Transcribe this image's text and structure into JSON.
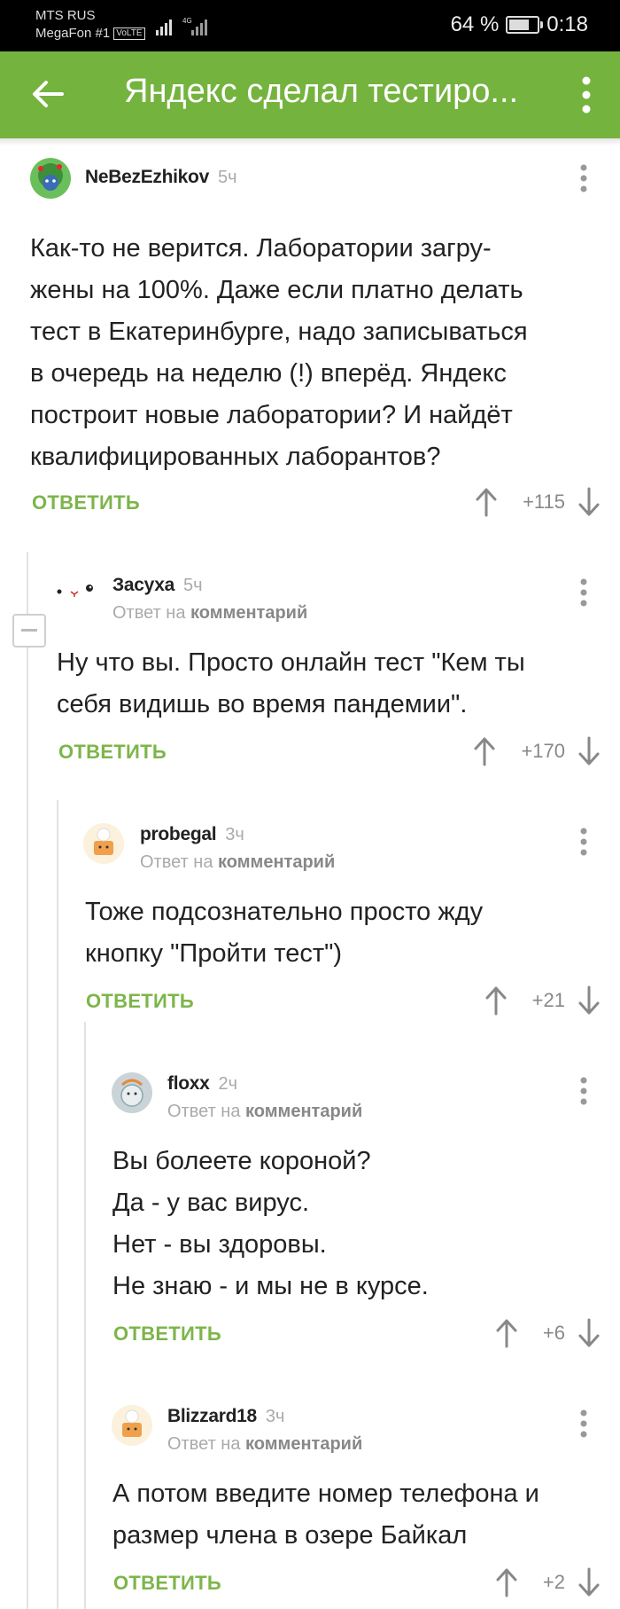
{
  "status_bar": {
    "carrier1": "MTS RUS",
    "carrier2": "MegaFon #1",
    "volte": "VoLTE",
    "network": "4G",
    "battery": "64 %",
    "battery_level": 0.64,
    "time": "0:18"
  },
  "app_bar": {
    "title": "Яндекс сделал тестиро..."
  },
  "comments": [
    {
      "author": "NeBezEzhikov",
      "time": "5ч",
      "lines": [
        "Как-то не верится. Лаборатории загру-",
        "жены на 100%. Даже если платно делать",
        "тест в Екатеринбурге, надо записываться",
        "в очередь на неделю (!) вперёд. Яндекс",
        "построит новые лаборатории? И найдёт",
        "квалифицированных лаборантов?"
      ],
      "reply_label": "ОТВЕТИТЬ",
      "rating": "+115"
    },
    {
      "author": "Засуха",
      "time": "5ч",
      "reply_prefix": "Ответ на",
      "reply_target": "комментарий",
      "lines": [
        "Ну что вы. Просто онлайн тест \"Кем ты",
        "себя видишь во время пандемии\"."
      ],
      "reply_label": "ОТВЕТИТЬ",
      "rating": "+170"
    },
    {
      "author": "probegal",
      "time": "3ч",
      "reply_prefix": "Ответ на",
      "reply_target": "комментарий",
      "lines": [
        "Тоже подсознательно просто жду",
        "кнопку \"Пройти тест\")"
      ],
      "reply_label": "ОТВЕТИТЬ",
      "rating": "+21"
    },
    {
      "author": "floxx",
      "time": "2ч",
      "reply_prefix": "Ответ на",
      "reply_target": "комментарий",
      "lines": [
        "Вы болеете короной?",
        "Да - у вас вирус.",
        "Нет - вы здоровы.",
        "Не знаю - и мы не в курсе."
      ],
      "reply_label": "ОТВЕТИТЬ",
      "rating": "+6"
    },
    {
      "author": "Blizzard18",
      "time": "3ч",
      "reply_prefix": "Ответ на",
      "reply_target": "комментарий",
      "lines": [
        "А потом введите номер телефона и",
        "размер члена в озере Байкал"
      ],
      "reply_label": "ОТВЕТИТЬ",
      "rating": "+2"
    }
  ],
  "icons": {
    "back": "arrow-left-icon",
    "more": "more-vertical-icon",
    "upvote": "arrow-up-icon",
    "downvote": "arrow-down-icon",
    "collapse": "collapse-minus-icon"
  },
  "colors": {
    "brand": "#75b33f",
    "reply": "#7db54a",
    "muted": "#aaaaaa"
  }
}
